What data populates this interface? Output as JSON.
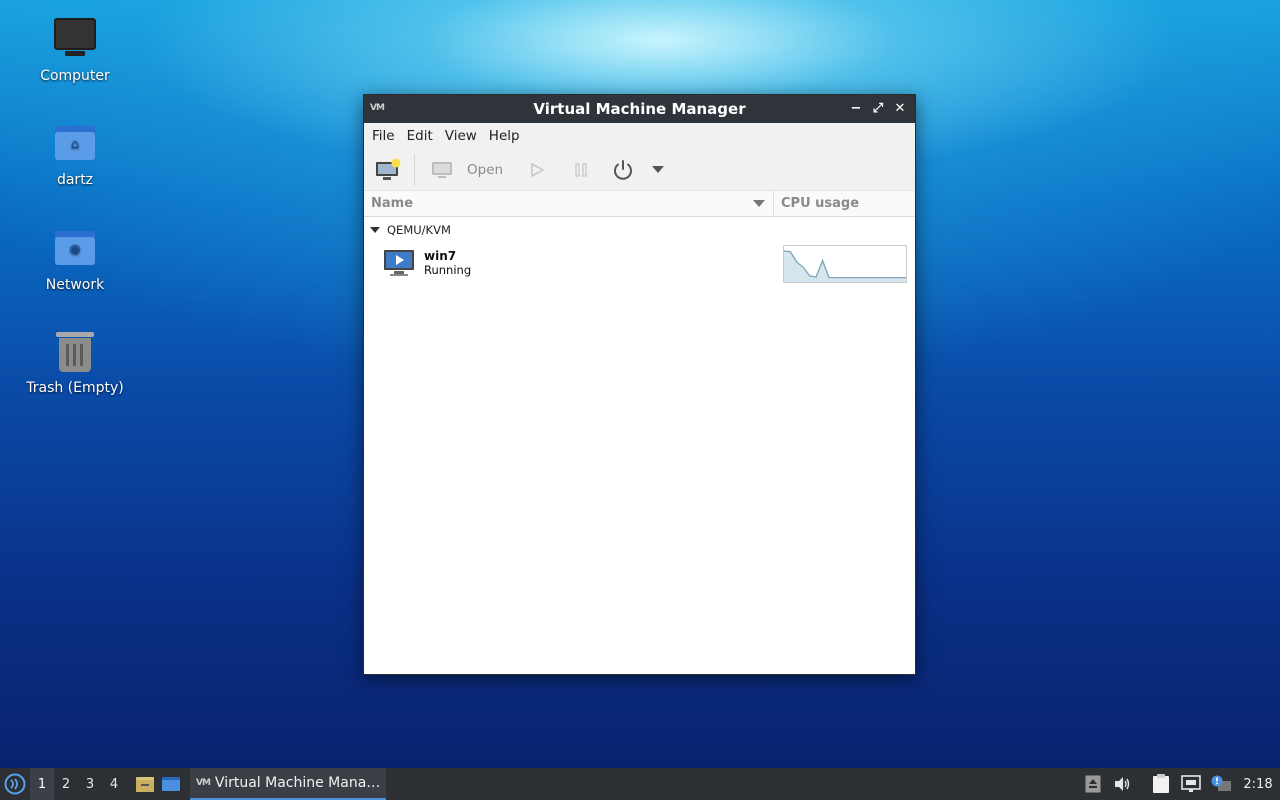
{
  "desktop": {
    "icons": [
      {
        "label": "Computer",
        "icon": "computer-icon"
      },
      {
        "label": "dartz",
        "icon": "home-folder-icon"
      },
      {
        "label": "Network",
        "icon": "network-folder-icon"
      },
      {
        "label": "Trash (Empty)",
        "icon": "trash-icon"
      }
    ]
  },
  "window": {
    "title": "Virtual Machine Manager",
    "menu": [
      "File",
      "Edit",
      "View",
      "Help"
    ],
    "toolbar": {
      "new_vm_icon": "new-vm-icon",
      "open_label": "Open",
      "run_icon": "play-icon",
      "pause_icon": "pause-icon",
      "shutdown_icon": "power-icon",
      "more_icon": "dropdown-arrow-icon"
    },
    "columns": {
      "name": "Name",
      "cpu": "CPU usage"
    },
    "group": "QEMU/KVM",
    "vms": [
      {
        "name": "win7",
        "status": "Running",
        "cpu_history": [
          0.88,
          0.86,
          0.55,
          0.4,
          0.15,
          0.12,
          0.6,
          0.1,
          0.1,
          0.1,
          0.1,
          0.1,
          0.1,
          0.1,
          0.1,
          0.1,
          0.1,
          0.1,
          0.1,
          0.1
        ]
      }
    ]
  },
  "taskbar": {
    "workspaces": [
      "1",
      "2",
      "3",
      "4"
    ],
    "active_workspace": "1",
    "task_label": "Virtual Machine Mana…",
    "clock": "2:18",
    "colors": {
      "accent": "#4f8fd8",
      "panel": "#2c3035"
    }
  }
}
